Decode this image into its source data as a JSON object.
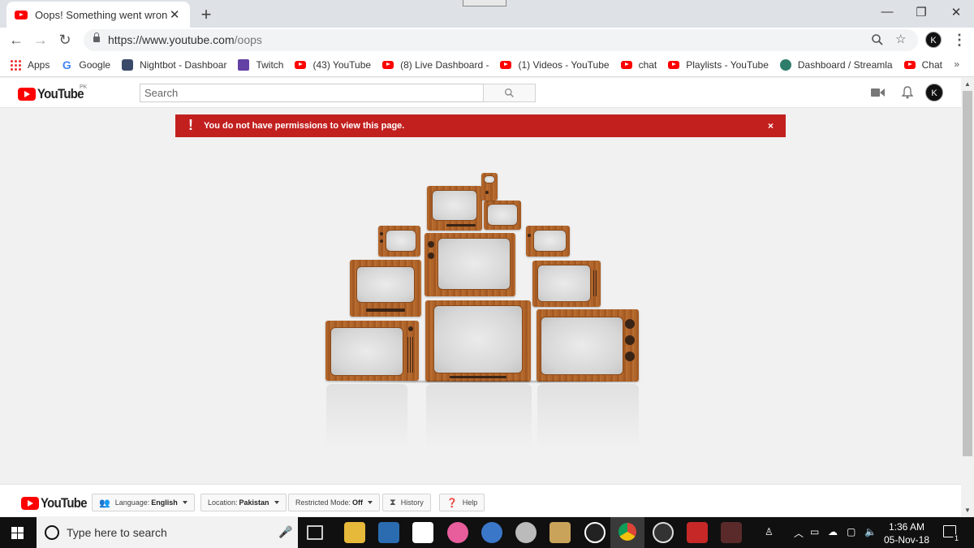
{
  "browser": {
    "tab_title": "Oops! Something went wrong. -",
    "tab_close": "✕",
    "new_tab": "+",
    "window_controls": {
      "minimize": "—",
      "restore": "❐",
      "close": "✕"
    },
    "url_host": "https://www.youtube.com",
    "url_path": "/oops",
    "profile_initial": "K"
  },
  "bookmarks": [
    {
      "label": "Apps",
      "icon": "apps-grid-icon"
    },
    {
      "label": "Google",
      "icon": "google-icon"
    },
    {
      "label": "Nightbot - Dashboar",
      "icon": "nightbot-icon"
    },
    {
      "label": "Twitch",
      "icon": "twitch-icon"
    },
    {
      "label": "(43) YouTube",
      "icon": "youtube-icon"
    },
    {
      "label": "(8) Live Dashboard -",
      "icon": "youtube-icon"
    },
    {
      "label": "(1) Videos - YouTube",
      "icon": "youtube-icon"
    },
    {
      "label": "chat",
      "icon": "youtube-icon"
    },
    {
      "label": "Playlists - YouTube",
      "icon": "youtube-icon"
    },
    {
      "label": "Dashboard / Streamla",
      "icon": "streamlabs-icon"
    },
    {
      "label": "Chat",
      "icon": "youtube-icon"
    }
  ],
  "bookmarks_more": "»",
  "youtube": {
    "logo_text": "YouTube",
    "region": "PK",
    "search_placeholder": "Search",
    "profile_initial": "K",
    "alert_message": "You do not have permissions to view this page.",
    "alert_icon": "!",
    "alert_close": "×"
  },
  "footer": {
    "logo_text": "YouTube",
    "language_label": "Language:",
    "language_value": "English",
    "location_label": "Location:",
    "location_value": "Pakistan",
    "restricted_label": "Restricted Mode:",
    "restricted_value": "Off",
    "history_label": "History",
    "help_label": "Help"
  },
  "taskbar": {
    "search_placeholder": "Type here to search",
    "time": "1:36 AM",
    "date": "05-Nov-18",
    "notification_count": "1"
  },
  "colors": {
    "youtube_red": "#ff0000",
    "alert_red": "#c2201f",
    "tab_strip": "#dee1e6",
    "taskbar": "#101010"
  }
}
